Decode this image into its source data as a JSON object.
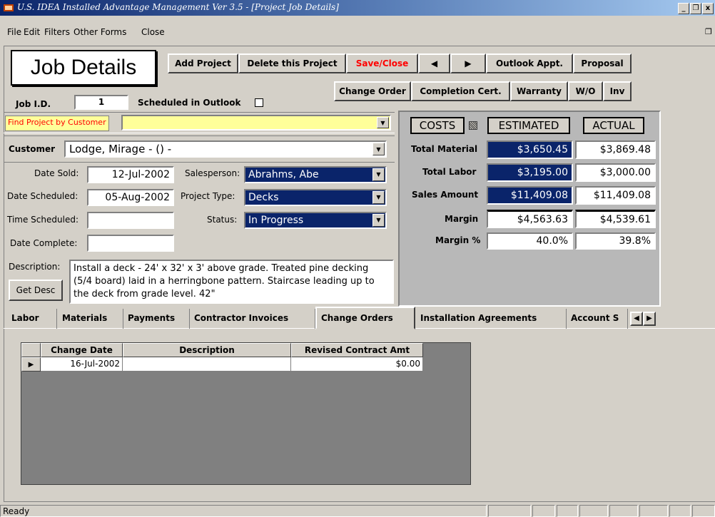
{
  "window": {
    "title": "U.S. IDEA Installed Advantage Management Ver 3.5 - [Project Job Details]",
    "min": "_",
    "restore": "❐",
    "close": "x"
  },
  "menu": {
    "file": "File",
    "edit": "Edit",
    "filters": "Filters",
    "other_forms": "Other Forms",
    "close": "Close"
  },
  "form": {
    "heading": "Job Details",
    "job_id_label": "Job I.D.",
    "job_id": "1",
    "scheduled_outlook_label": "Scheduled in Outlook",
    "buttons": {
      "add_project": "Add Project",
      "delete_project": "Delete this Project",
      "save_close": "Save/Close",
      "prev": "◀",
      "next": "▶",
      "outlook_appt": "Outlook Appt.",
      "proposal": "Proposal",
      "change_order": "Change Order",
      "completion_cert": "Completion Cert.",
      "warranty": "Warranty",
      "wo": "W/O",
      "inv": "Inv",
      "get_desc": "Get Desc"
    },
    "find_label": "Find Project by Customer",
    "find_value": "",
    "customer_label": "Customer",
    "customer_value": "Lodge, Mirage -  () -",
    "date_sold_label": "Date Sold:",
    "date_sold": "12-Jul-2002",
    "date_scheduled_label": "Date Scheduled:",
    "date_scheduled": "05-Aug-2002",
    "time_scheduled_label": "Time Scheduled:",
    "time_scheduled": "",
    "date_complete_label": "Date Complete:",
    "date_complete": "",
    "salesperson_label": "Salesperson:",
    "salesperson": "Abrahms, Abe",
    "project_type_label": "Project Type:",
    "project_type": "Decks",
    "status_label": "Status:",
    "status": "In Progress",
    "description_label": "Description:",
    "description": "Install a deck - 24' x 32' x 3' above grade. Treated pine decking (5/4 board) laid in a herringbone pattern. Staircase leading up to the deck from grade level. 42\""
  },
  "costs": {
    "costs_label": "COSTS",
    "estimated_label": "ESTIMATED",
    "actual_label": "ACTUAL",
    "rows": [
      {
        "label": "Total Material",
        "estimated": "$3,650.45",
        "actual": "$3,869.48"
      },
      {
        "label": "Total Labor",
        "estimated": "$3,195.00",
        "actual": "$3,000.00"
      },
      {
        "label": "Sales Amount",
        "estimated": "$11,409.08",
        "actual": "$11,409.08"
      },
      {
        "label": "Margin",
        "estimated": "$4,563.63",
        "actual": "$4,539.61"
      },
      {
        "label": "Margin %",
        "estimated": "40.0%",
        "actual": "39.8%"
      }
    ]
  },
  "tabs": [
    "Labor",
    "Materials",
    "Payments",
    "Contractor Invoices",
    "Change Orders",
    "Installation Agreements",
    "Account S"
  ],
  "active_tab": "Change Orders",
  "grid": {
    "headers": [
      "Change Date",
      "Description",
      "Revised Contract Amt"
    ],
    "rows": [
      {
        "date": "16-Jul-2002",
        "description": "",
        "amount": "$0.00"
      }
    ]
  },
  "status": {
    "text": "Ready"
  },
  "colors": {
    "titlebar": "#0a246a",
    "selected_field": "#0a246a",
    "find_field": "#ffff99",
    "save_close": "#ff0000"
  }
}
